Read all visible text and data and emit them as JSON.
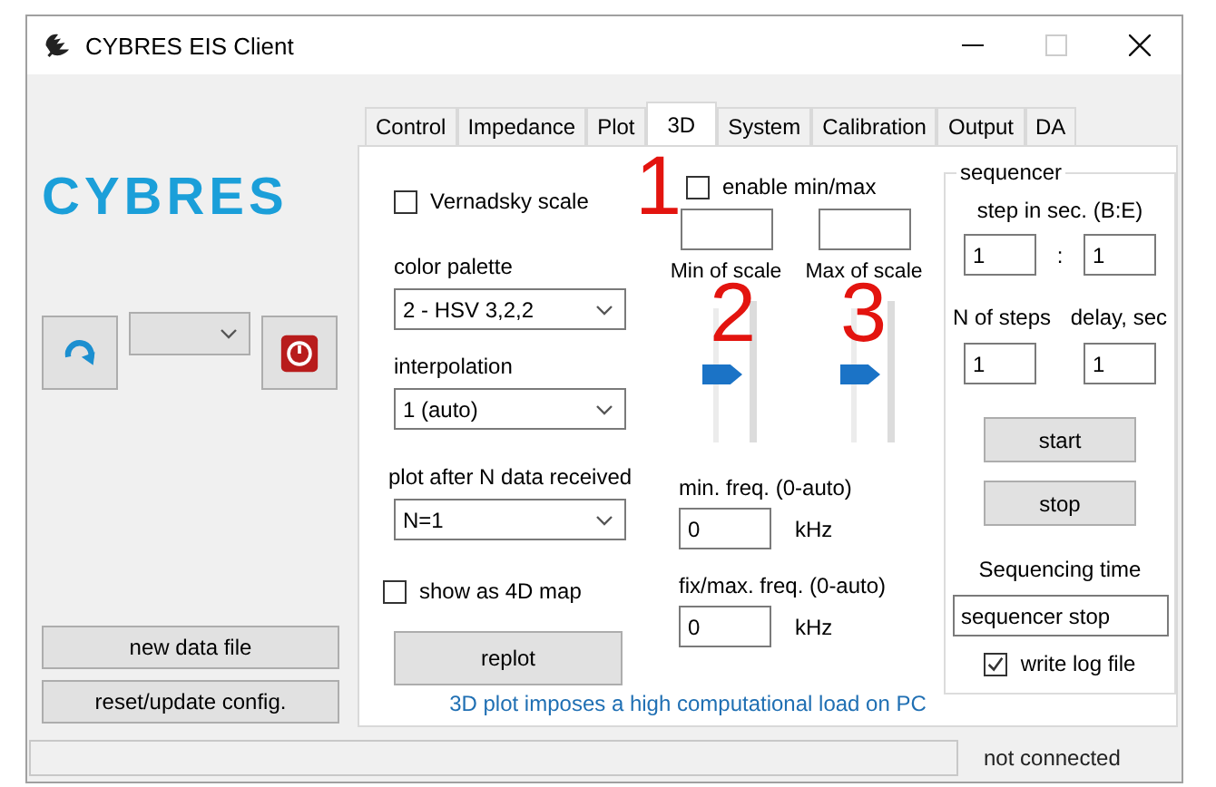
{
  "window": {
    "title": "CYBRES EIS Client"
  },
  "logo": {
    "text": "CYBRES"
  },
  "left_buttons": [
    {
      "label": "new data file"
    },
    {
      "label": "reset/update config."
    }
  ],
  "tabs": [
    {
      "label": "Control",
      "selected": false
    },
    {
      "label": "Impedance",
      "selected": false
    },
    {
      "label": "Plot",
      "selected": false
    },
    {
      "label": "3D",
      "selected": true
    },
    {
      "label": "System",
      "selected": false
    },
    {
      "label": "Calibration",
      "selected": false
    },
    {
      "label": "Output",
      "selected": false
    },
    {
      "label": "DA",
      "selected": false
    }
  ],
  "plot3d": {
    "vernadsky_scale": {
      "label": "Vernadsky scale",
      "checked": false
    },
    "color_palette": {
      "label": "color palette",
      "value": "2 - HSV 3,2,2"
    },
    "interpolation": {
      "label": "interpolation",
      "value": "1 (auto)"
    },
    "plot_after": {
      "label": "plot after N data received",
      "value": "N=1"
    },
    "show_4d": {
      "label": "show as 4D map",
      "checked": false
    },
    "replot": "replot",
    "enable_minmax": {
      "label": "enable min/max",
      "checked": false
    },
    "min_scale": {
      "label": "Min of scale",
      "level": 0.5
    },
    "max_scale": {
      "label": "Max of scale",
      "level": 0.5
    },
    "min_freq": {
      "label": "min. freq. (0-auto)",
      "value": "0",
      "unit": "kHz"
    },
    "max_freq": {
      "label": "fix/max. freq. (0-auto)",
      "value": "0",
      "unit": "kHz"
    },
    "note": "3D plot imposes a high computational load on PC"
  },
  "sequencer": {
    "title": "sequencer",
    "step_label": "step in sec. (B:E)",
    "begin": "1",
    "separator": ":",
    "end": "1",
    "steps_label": "N of steps",
    "steps": "1",
    "delay_label": "delay, sec",
    "delay": "1",
    "buttons": [
      "start",
      "stop"
    ],
    "time_label": "Sequencing time",
    "time": "sequencer stop",
    "log": {
      "label": "write log file",
      "checked": true
    }
  },
  "annotations": [
    "1",
    "2",
    "3"
  ],
  "status_bar": {
    "text": "not connected"
  }
}
